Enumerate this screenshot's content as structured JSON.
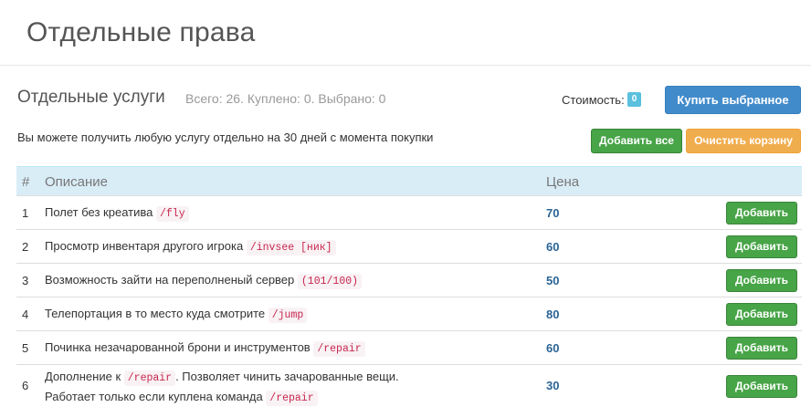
{
  "page": {
    "title": "Отдельные права"
  },
  "section": {
    "title": "Отдельные услуги",
    "stats": "Всего: 26. Куплено: 0. Выбрано: 0"
  },
  "cost": {
    "label": "Стоимость:",
    "value": "0"
  },
  "buttons": {
    "buy_selected": "Купить выбранное",
    "add_all": "Добавить все",
    "clear_cart": "Очистить корзину"
  },
  "info_text": "Вы можете получить любую услугу отдельно на 30 дней с момента покупки",
  "table": {
    "headers": {
      "num": "#",
      "description": "Описание",
      "price": "Цена"
    },
    "add_label": "Добавить",
    "rows": [
      {
        "num": "1",
        "text": "Полет без креатива",
        "code": "/fly",
        "price": "70"
      },
      {
        "num": "2",
        "text": "Просмотр инвентаря другого игрока",
        "code": "/invsee [ник]",
        "price": "60"
      },
      {
        "num": "3",
        "text": "Возможность зайти на переполненый сервер",
        "code": "(101/100)",
        "price": "50"
      },
      {
        "num": "4",
        "text": "Телепортация в то место куда смотрите",
        "code": "/jump",
        "price": "80"
      },
      {
        "num": "5",
        "text": "Починка незачарованной брони и инструментов",
        "code": "/repair",
        "price": "60"
      },
      {
        "num": "6",
        "text_before": "Дополнение к",
        "code": "/repair",
        "text_after": ". Позволяет чинить зачарованные вещи.",
        "line2": "Работает только если куплена команда",
        "code2": "/repair",
        "price": "30"
      }
    ]
  }
}
